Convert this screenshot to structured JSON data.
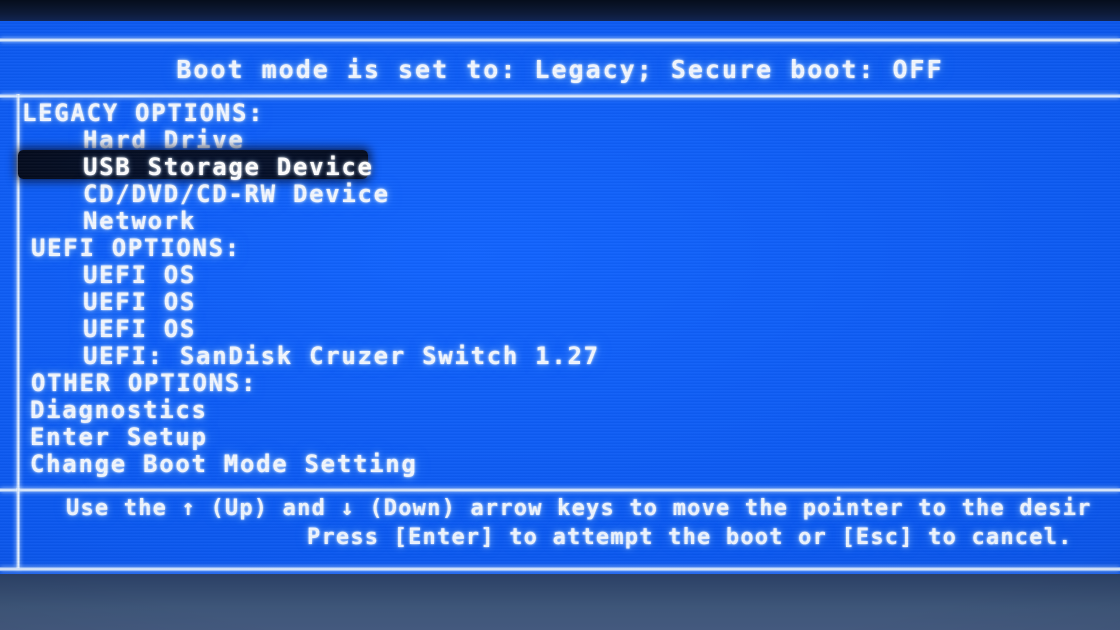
{
  "screen": {
    "header": "Boot mode is set to: Legacy; Secure boot: OFF",
    "colors": {
      "background_blue": "#0b58ef",
      "text": "#f2f7ff",
      "highlight_bar": "#030a1c",
      "rule": "#eaf3ff",
      "bezel_top": "#0d1a36",
      "bezel_bottom": "#3e5679"
    }
  },
  "menu": {
    "rows": [
      {
        "label": "LEGACY OPTIONS:",
        "kind": "section",
        "indent": "header",
        "selected": false
      },
      {
        "label": "Hard Drive",
        "kind": "item",
        "indent": "item",
        "selected": false
      },
      {
        "label": "USB Storage Device",
        "kind": "item",
        "indent": "item",
        "selected": true
      },
      {
        "label": "CD/DVD/CD-RW Device",
        "kind": "item",
        "indent": "item",
        "selected": false
      },
      {
        "label": "Network",
        "kind": "item",
        "indent": "item",
        "selected": false
      },
      {
        "label": "UEFI OPTIONS:",
        "kind": "section",
        "indent": "header2",
        "selected": false
      },
      {
        "label": "UEFI OS",
        "kind": "item",
        "indent": "item",
        "selected": false
      },
      {
        "label": "UEFI OS",
        "kind": "item",
        "indent": "item",
        "selected": false
      },
      {
        "label": "UEFI OS",
        "kind": "item",
        "indent": "item",
        "selected": false
      },
      {
        "label": "UEFI: SanDisk Cruzer Switch 1.27",
        "kind": "item",
        "indent": "item",
        "selected": false
      },
      {
        "label": "OTHER OPTIONS:",
        "kind": "section",
        "indent": "header2",
        "selected": false
      },
      {
        "label": "Diagnostics",
        "kind": "item",
        "indent": "flush",
        "selected": false
      },
      {
        "label": "Enter Setup",
        "kind": "item",
        "indent": "flush",
        "selected": false
      },
      {
        "label": "Change Boot Mode Setting",
        "kind": "item",
        "indent": "flush",
        "selected": false
      }
    ],
    "selected_label": "USB Storage Device"
  },
  "footer": {
    "line1": "Use the ↑ (Up) and ↓ (Down) arrow keys to move the pointer to the desir",
    "line2": "Press [Enter] to attempt the boot or [Esc] to cancel.",
    "keys": {
      "up_arrow": "↑",
      "down_arrow": "↓",
      "enter": "[Enter]",
      "escape": "[Esc]"
    }
  }
}
